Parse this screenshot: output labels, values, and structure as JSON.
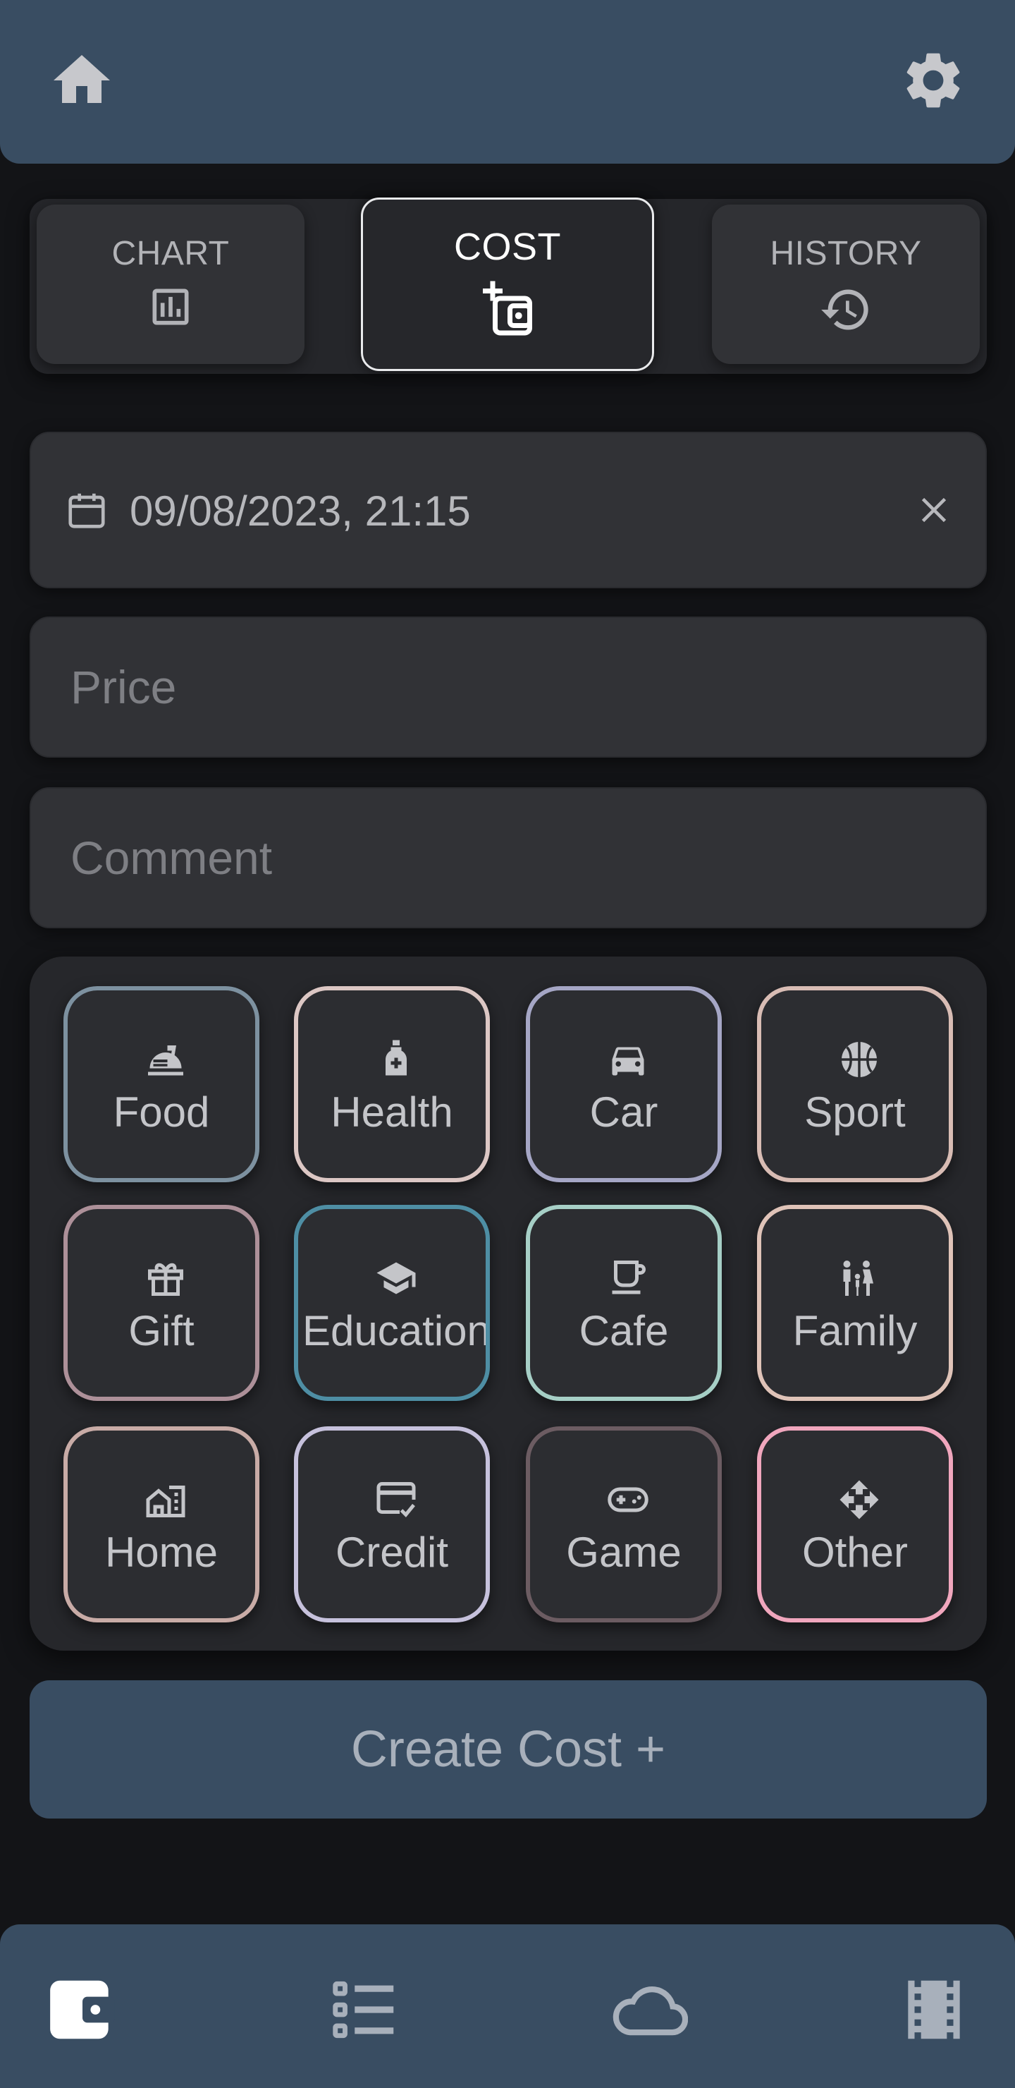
{
  "header": {
    "home_icon": "home-icon",
    "settings_icon": "gear-icon"
  },
  "tabs": [
    {
      "label": "CHART",
      "icon": "bar-chart-icon"
    },
    {
      "label": "COST",
      "icon": "add-wallet-icon",
      "active": true
    },
    {
      "label": "HISTORY",
      "icon": "history-icon"
    }
  ],
  "form": {
    "date_value": "09/08/2023, 21:15",
    "price_placeholder": "Price",
    "comment_placeholder": "Comment"
  },
  "categories": [
    {
      "label": "Food",
      "color": "#7d91a0",
      "icon": "food-tray-icon"
    },
    {
      "label": "Health",
      "color": "#dcc7c4",
      "icon": "medicine-bottle-icon"
    },
    {
      "label": "Car",
      "color": "#a5a6c5",
      "icon": "car-icon"
    },
    {
      "label": "Sport",
      "color": "#d8bcb4",
      "icon": "basketball-icon"
    },
    {
      "label": "Gift",
      "color": "#ad9099",
      "icon": "gift-icon"
    },
    {
      "label": "Education",
      "color": "#4e8ea4",
      "icon": "graduation-cap-icon"
    },
    {
      "label": "Cafe",
      "color": "#a6cfc6",
      "icon": "coffee-cup-icon"
    },
    {
      "label": "Family",
      "color": "#dfc3b8",
      "icon": "family-icon"
    },
    {
      "label": "Home",
      "color": "#c8aba6",
      "icon": "house-icon"
    },
    {
      "label": "Credit",
      "color": "#c6c1dc",
      "icon": "credit-card-icon"
    },
    {
      "label": "Game",
      "color": "#6c5c62",
      "icon": "gamepad-icon"
    },
    {
      "label": "Other",
      "color": "#f0a6bd",
      "icon": "move-arrows-icon"
    }
  ],
  "create_button": {
    "label": "Create Cost  +"
  },
  "bottom_nav": [
    {
      "icon": "wallet-icon",
      "active": true
    },
    {
      "icon": "list-icon"
    },
    {
      "icon": "cloud-icon"
    },
    {
      "icon": "film-icon"
    }
  ],
  "colors": {
    "background": "#131417",
    "bar": "#394d62",
    "panel": "#313236",
    "text": "#b2b3b7",
    "icon": "#c7c8cc"
  }
}
